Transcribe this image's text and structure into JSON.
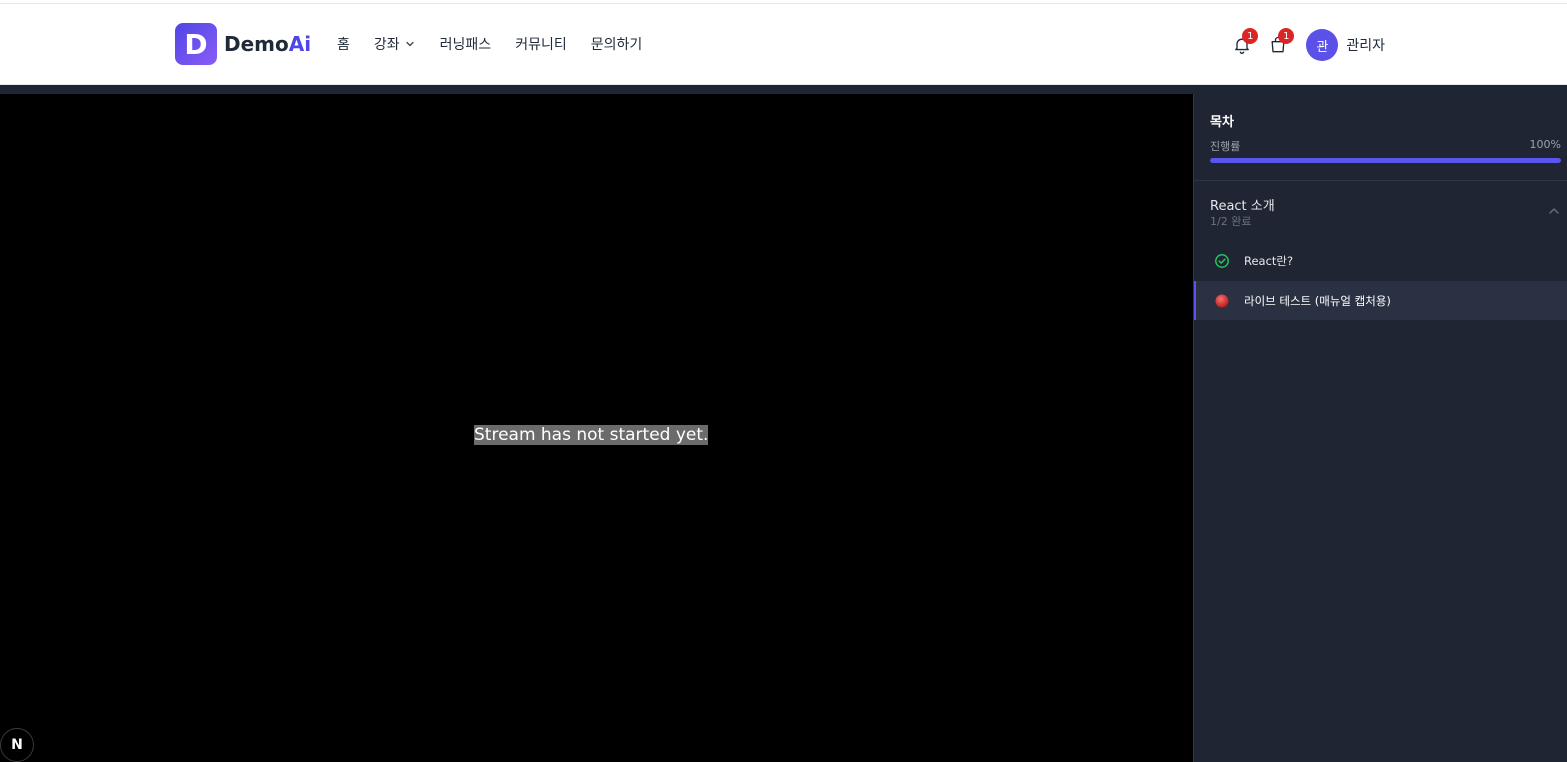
{
  "brand": {
    "mark": "D",
    "name_main": "Demo",
    "name_accent": "Ai"
  },
  "nav": [
    {
      "label": "홈"
    },
    {
      "label": "강좌"
    },
    {
      "label": "러닝패스"
    },
    {
      "label": "커뮤니티"
    },
    {
      "label": "문의하기"
    }
  ],
  "header_right": {
    "notifications_count": "1",
    "cart_count": "1",
    "avatar_initial": "관",
    "username": "관리자"
  },
  "video": {
    "message": "Stream has not started yet.",
    "corner_badge": "N"
  },
  "sidebar": {
    "title": "목차",
    "progress_label": "진행률",
    "progress_value": "100%",
    "progress_percent": 100,
    "section": {
      "title": "React 소개",
      "subtitle": "1/2 완료",
      "lessons": [
        {
          "label": "React란?",
          "status": "completed"
        },
        {
          "label": "라이브 테스트 (매뉴얼 캡처용)",
          "status": "live"
        }
      ]
    }
  },
  "colors": {
    "accent": "#5b55f0",
    "sidebar_bg": "#1f2532",
    "completed_green": "#22c55e",
    "live_red": "#dc2626",
    "badge_red": "#dc2626"
  }
}
